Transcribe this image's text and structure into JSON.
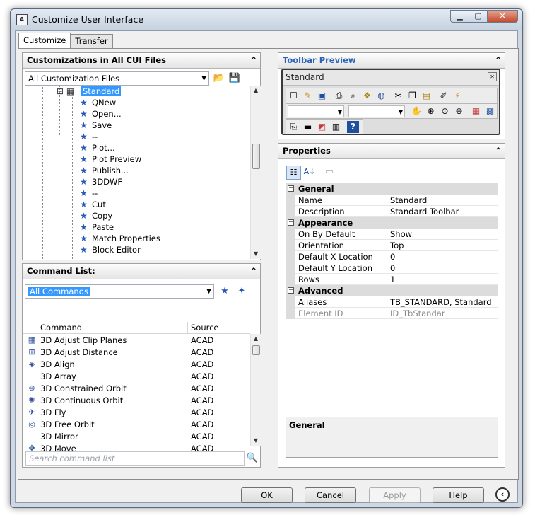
{
  "window": {
    "title": "Customize User Interface"
  },
  "tabs": [
    "Customize",
    "Transfer"
  ],
  "customizations_panel": {
    "title": "Customizations in All CUI Files",
    "combo_value": "All Customization Files",
    "tree_items": [
      {
        "label": "Standard",
        "icon": "toolbar-icon",
        "selected": true
      },
      {
        "label": "QNew",
        "icon": "star-icon"
      },
      {
        "label": "Open...",
        "icon": "star-icon"
      },
      {
        "label": "Save",
        "icon": "star-icon"
      },
      {
        "label": "--",
        "icon": "star-icon"
      },
      {
        "label": "Plot...",
        "icon": "star-icon"
      },
      {
        "label": "Plot Preview",
        "icon": "star-icon"
      },
      {
        "label": "Publish...",
        "icon": "star-icon"
      },
      {
        "label": "3DDWF",
        "icon": "star-icon"
      },
      {
        "label": "--",
        "icon": "star-icon"
      },
      {
        "label": "Cut",
        "icon": "star-icon"
      },
      {
        "label": "Copy",
        "icon": "star-icon"
      },
      {
        "label": "Paste",
        "icon": "star-icon"
      },
      {
        "label": "Match Properties",
        "icon": "star-icon"
      },
      {
        "label": "Block Editor",
        "icon": "star-icon"
      }
    ]
  },
  "command_list_panel": {
    "title": "Command List:",
    "filter_value": "All Commands",
    "columns": [
      "Command",
      "Source"
    ],
    "rows": [
      {
        "command": "3D Adjust Clip Planes",
        "source": "ACAD",
        "icon": "clip-planes-icon"
      },
      {
        "command": "3D Adjust Distance",
        "source": "ACAD",
        "icon": "adjust-distance-icon"
      },
      {
        "command": "3D Align",
        "source": "ACAD",
        "icon": "align-icon"
      },
      {
        "command": "3D Array",
        "source": "ACAD",
        "icon": ""
      },
      {
        "command": "3D Constrained Orbit",
        "source": "ACAD",
        "icon": "orbit-icon"
      },
      {
        "command": "3D Continuous Orbit",
        "source": "ACAD",
        "icon": "continuous-orbit-icon"
      },
      {
        "command": "3D Fly",
        "source": "ACAD",
        "icon": "fly-icon"
      },
      {
        "command": "3D Free Orbit",
        "source": "ACAD",
        "icon": "free-orbit-icon"
      },
      {
        "command": "3D Mirror",
        "source": "ACAD",
        "icon": ""
      },
      {
        "command": "3D Move",
        "source": "ACAD",
        "icon": "move-icon"
      }
    ],
    "search_placeholder": "Search command list"
  },
  "toolbar_preview_panel": {
    "title": "Toolbar Preview",
    "toolbar_name": "Standard"
  },
  "properties_panel": {
    "title": "Properties",
    "categories": [
      {
        "name": "General",
        "rows": [
          {
            "key": "Name",
            "value": "Standard"
          },
          {
            "key": "Description",
            "value": "Standard Toolbar"
          }
        ]
      },
      {
        "name": "Appearance",
        "rows": [
          {
            "key": "On By Default",
            "value": "Show"
          },
          {
            "key": "Orientation",
            "value": "Top"
          },
          {
            "key": "Default X Location",
            "value": "0"
          },
          {
            "key": "Default Y Location",
            "value": "0"
          },
          {
            "key": "Rows",
            "value": "1"
          }
        ]
      },
      {
        "name": "Advanced",
        "rows": [
          {
            "key": "Aliases",
            "value": "TB_STANDARD, Standard"
          },
          {
            "key": "Element ID",
            "value": "ID_TbStandar",
            "disabled": true
          }
        ]
      }
    ],
    "description_title": "General"
  },
  "buttons": {
    "ok": "OK",
    "cancel": "Cancel",
    "apply": "Apply",
    "help": "Help"
  }
}
